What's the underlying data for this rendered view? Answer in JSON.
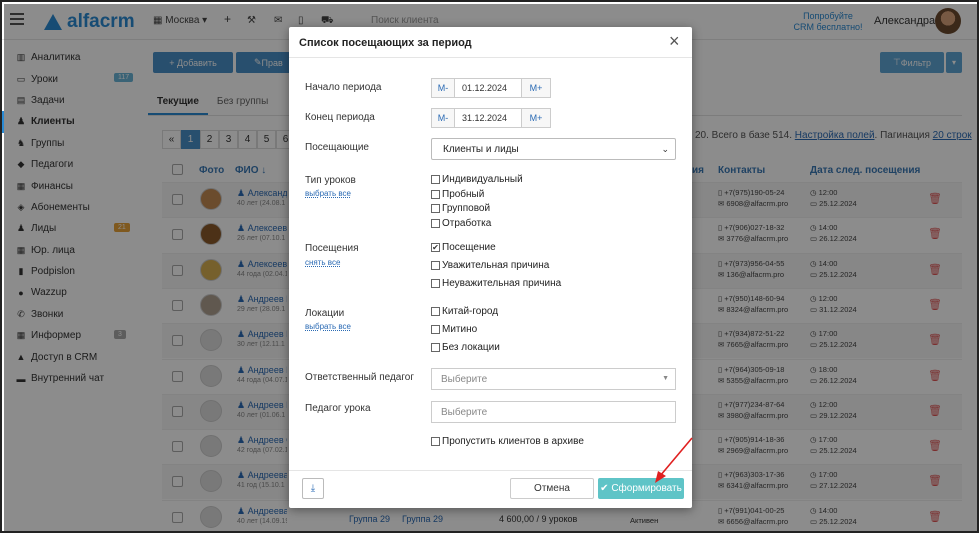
{
  "topbar": {
    "city": "Москва",
    "search_placeholder": "Поиск клиента",
    "try_line1": "Попробуйте",
    "try_line2": "CRM бесплатно!",
    "user": "Александра",
    "logo": "alfacrm"
  },
  "sidebar": {
    "items": [
      {
        "icon": "chart-icon",
        "label": "Аналитика"
      },
      {
        "icon": "monitor-icon",
        "label": "Уроки",
        "badge": "117",
        "badge_color": "#6ab4d8"
      },
      {
        "icon": "clipboard-icon",
        "label": "Задачи"
      },
      {
        "icon": "user-icon",
        "label": "Клиенты",
        "active": true
      },
      {
        "icon": "users-icon",
        "label": "Группы"
      },
      {
        "icon": "graduation-icon",
        "label": "Педагоги"
      },
      {
        "icon": "money-icon",
        "label": "Финансы"
      },
      {
        "icon": "tag-icon",
        "label": "Абонементы"
      },
      {
        "icon": "user-plus-icon",
        "label": "Лиды",
        "badge": "21",
        "badge_color": "#e8a23a"
      },
      {
        "icon": "building-icon",
        "label": "Юр. лица"
      },
      {
        "icon": "file-icon",
        "label": "Podpislon"
      },
      {
        "icon": "whatsapp-icon",
        "label": "Wazzup"
      },
      {
        "icon": "phone-icon",
        "label": "Звонки"
      },
      {
        "icon": "info-icon",
        "label": "Информер",
        "badge": "3",
        "badge_color": "#aaaaaa"
      },
      {
        "icon": "lock-icon",
        "label": "Доступ в CRM"
      },
      {
        "icon": "chat-icon",
        "label": "Внутренний чат"
      }
    ]
  },
  "toolbar": {
    "add_label": "+ Добавить",
    "edit_label": "Прав",
    "filter_label": "Фильтр"
  },
  "tabs": [
    {
      "label": "Текущие",
      "active": true
    },
    {
      "label": "Без группы"
    }
  ],
  "pager": {
    "pages": [
      "«",
      "1",
      "2",
      "3",
      "4",
      "5",
      "6"
    ]
  },
  "info": {
    "text": "20. Всего в базе 514.",
    "settings_link": "Настройка полей",
    "pagination_label": "Пагинация",
    "pagination_value": "20 строк"
  },
  "table": {
    "headers": {
      "photo": "Фото",
      "name": "ФИО ↓",
      "status": "ия",
      "contacts": "Контакты",
      "next_visit": "Дата след. посещения"
    },
    "rows": [
      {
        "name": "Александр",
        "age": "40 лет (24.08.1",
        "phone": "+7(975)190-05-24",
        "email": "6908@alfacrm.pro",
        "time": "12:00",
        "date": "25.12.2024"
      },
      {
        "name": "Алексеева",
        "age": "26 лет (07.10.1",
        "phone": "+7(906)027-18-32",
        "email": "3776@alfacrm.pro",
        "time": "14:00",
        "date": "26.12.2024"
      },
      {
        "name": "Алексеева",
        "age": "44 года (02.04.1",
        "phone": "+7(973)956-04-55",
        "email": "136@alfacrm.pro",
        "time": "14:00",
        "date": "25.12.2024"
      },
      {
        "name": "Андреев Вл",
        "age": "29 лет (28.09.1",
        "phone": "+7(950)148-60-94",
        "email": "8324@alfacrm.pro",
        "time": "12:00",
        "date": "31.12.2024"
      },
      {
        "name": "Андреев Ев",
        "age": "30 лет (12.11.1",
        "phone": "+7(934)872-51-22",
        "email": "7665@alfacrm.pro",
        "time": "17:00",
        "date": "25.12.2024"
      },
      {
        "name": "Андреев И",
        "age": "44 года (04.07.1",
        "phone": "+7(964)305-09-18",
        "email": "5355@alfacrm.pro",
        "time": "18:00",
        "date": "26.12.2024"
      },
      {
        "name": "Андреев Ко",
        "age": "40 лет (01.06.1",
        "phone": "+7(977)234-87-64",
        "email": "3980@alfacrm.pro",
        "time": "12:00",
        "date": "29.12.2024"
      },
      {
        "name": "Андреев Са",
        "age": "42 года (07.02.1",
        "phone": "+7(905)914-18-36",
        "email": "2969@alfacrm.pro",
        "time": "17:00",
        "date": "25.12.2024"
      },
      {
        "name": "Андреева А",
        "age": "41 год (15.10.1",
        "phone": "+7(963)303-17-36",
        "email": "6341@alfacrm.pro",
        "time": "17:00",
        "date": "27.12.2024"
      },
      {
        "name": "Андреева Ксения",
        "age": "40 лет (14.09.1984)",
        "group1": "Группа 29",
        "group2": "Группа 29",
        "balance": "4 600,00 / 9 уроков",
        "status": "Активен",
        "phone": "+7(991)041-00-25",
        "email": "6656@alfacrm.pro",
        "time": "14:00",
        "date": "25.12.2024"
      }
    ]
  },
  "modal": {
    "title": "Список посещающих за период",
    "start_label": "Начало периода",
    "start_value": "01.12.2024",
    "end_label": "Конец периода",
    "end_value": "31.12.2024",
    "minus": "M-",
    "plus": "M+",
    "visitors_label": "Посещающие",
    "visitors_value": "Клиенты и лиды",
    "lesson_types_label": "Тип уроков",
    "lesson_types_link": "выбрать все",
    "lesson_types": [
      {
        "label": "Индивидуальный",
        "checked": false
      },
      {
        "label": "Пробный",
        "checked": false
      },
      {
        "label": "Групповой",
        "checked": false
      },
      {
        "label": "Отработка",
        "checked": false
      }
    ],
    "attendance_label": "Посещения",
    "attendance_link": "снять все",
    "attendance": [
      {
        "label": "Посещение",
        "checked": true
      },
      {
        "label": "Уважительная причина",
        "checked": false
      },
      {
        "label": "Неуважительная причина",
        "checked": false
      }
    ],
    "locations_label": "Локации",
    "locations_link": "выбрать все",
    "locations": [
      {
        "label": "Китай-город",
        "checked": false
      },
      {
        "label": "Митино",
        "checked": false
      },
      {
        "label": "Без локации",
        "checked": false
      }
    ],
    "resp_teacher_label": "Ответственный педагог",
    "resp_teacher_placeholder": "Выберите",
    "lesson_teacher_label": "Педагог урока",
    "lesson_teacher_placeholder": "Выберите",
    "skip_archive_label": "Пропустить клиентов в архиве",
    "cancel_label": "Отмена",
    "submit_label": "Сформировать"
  }
}
